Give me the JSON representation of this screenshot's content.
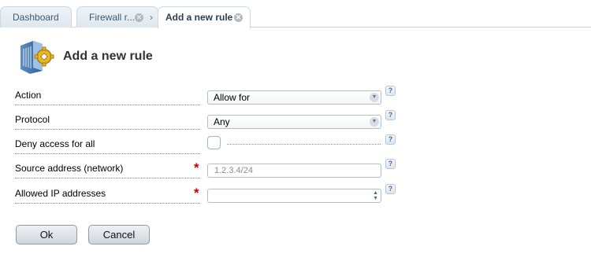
{
  "tabs": [
    {
      "label": "Dashboard"
    },
    {
      "label": "Firewall r..."
    },
    {
      "label": "Add a new rule"
    }
  ],
  "icons": {
    "tab_close": "close-circle-icon",
    "breadcrumb_separator": "chevron-right-icon",
    "header": "server-gear-icon",
    "help": "question-mark-icon"
  },
  "breadcrumb_separator": "›",
  "close_glyph": "✕",
  "page_title": "Add a new rule",
  "form": {
    "action": {
      "label": "Action",
      "value": "Allow for"
    },
    "protocol": {
      "label": "Protocol",
      "value": "Any"
    },
    "deny_all": {
      "label": "Deny access for all",
      "checked": false
    },
    "source": {
      "label": "Source address (network)",
      "required": true,
      "placeholder": "1.2.3.4/24",
      "value": ""
    },
    "allowed_ips": {
      "label": "Allowed IP addresses",
      "required": true,
      "value": ""
    }
  },
  "required_mark": "*",
  "help_mark": "?",
  "buttons": {
    "ok": "Ok",
    "cancel": "Cancel"
  },
  "colors": {
    "required": "#d10000",
    "tab_text": "#3d5a75",
    "help_icon": "#3f6d98"
  }
}
